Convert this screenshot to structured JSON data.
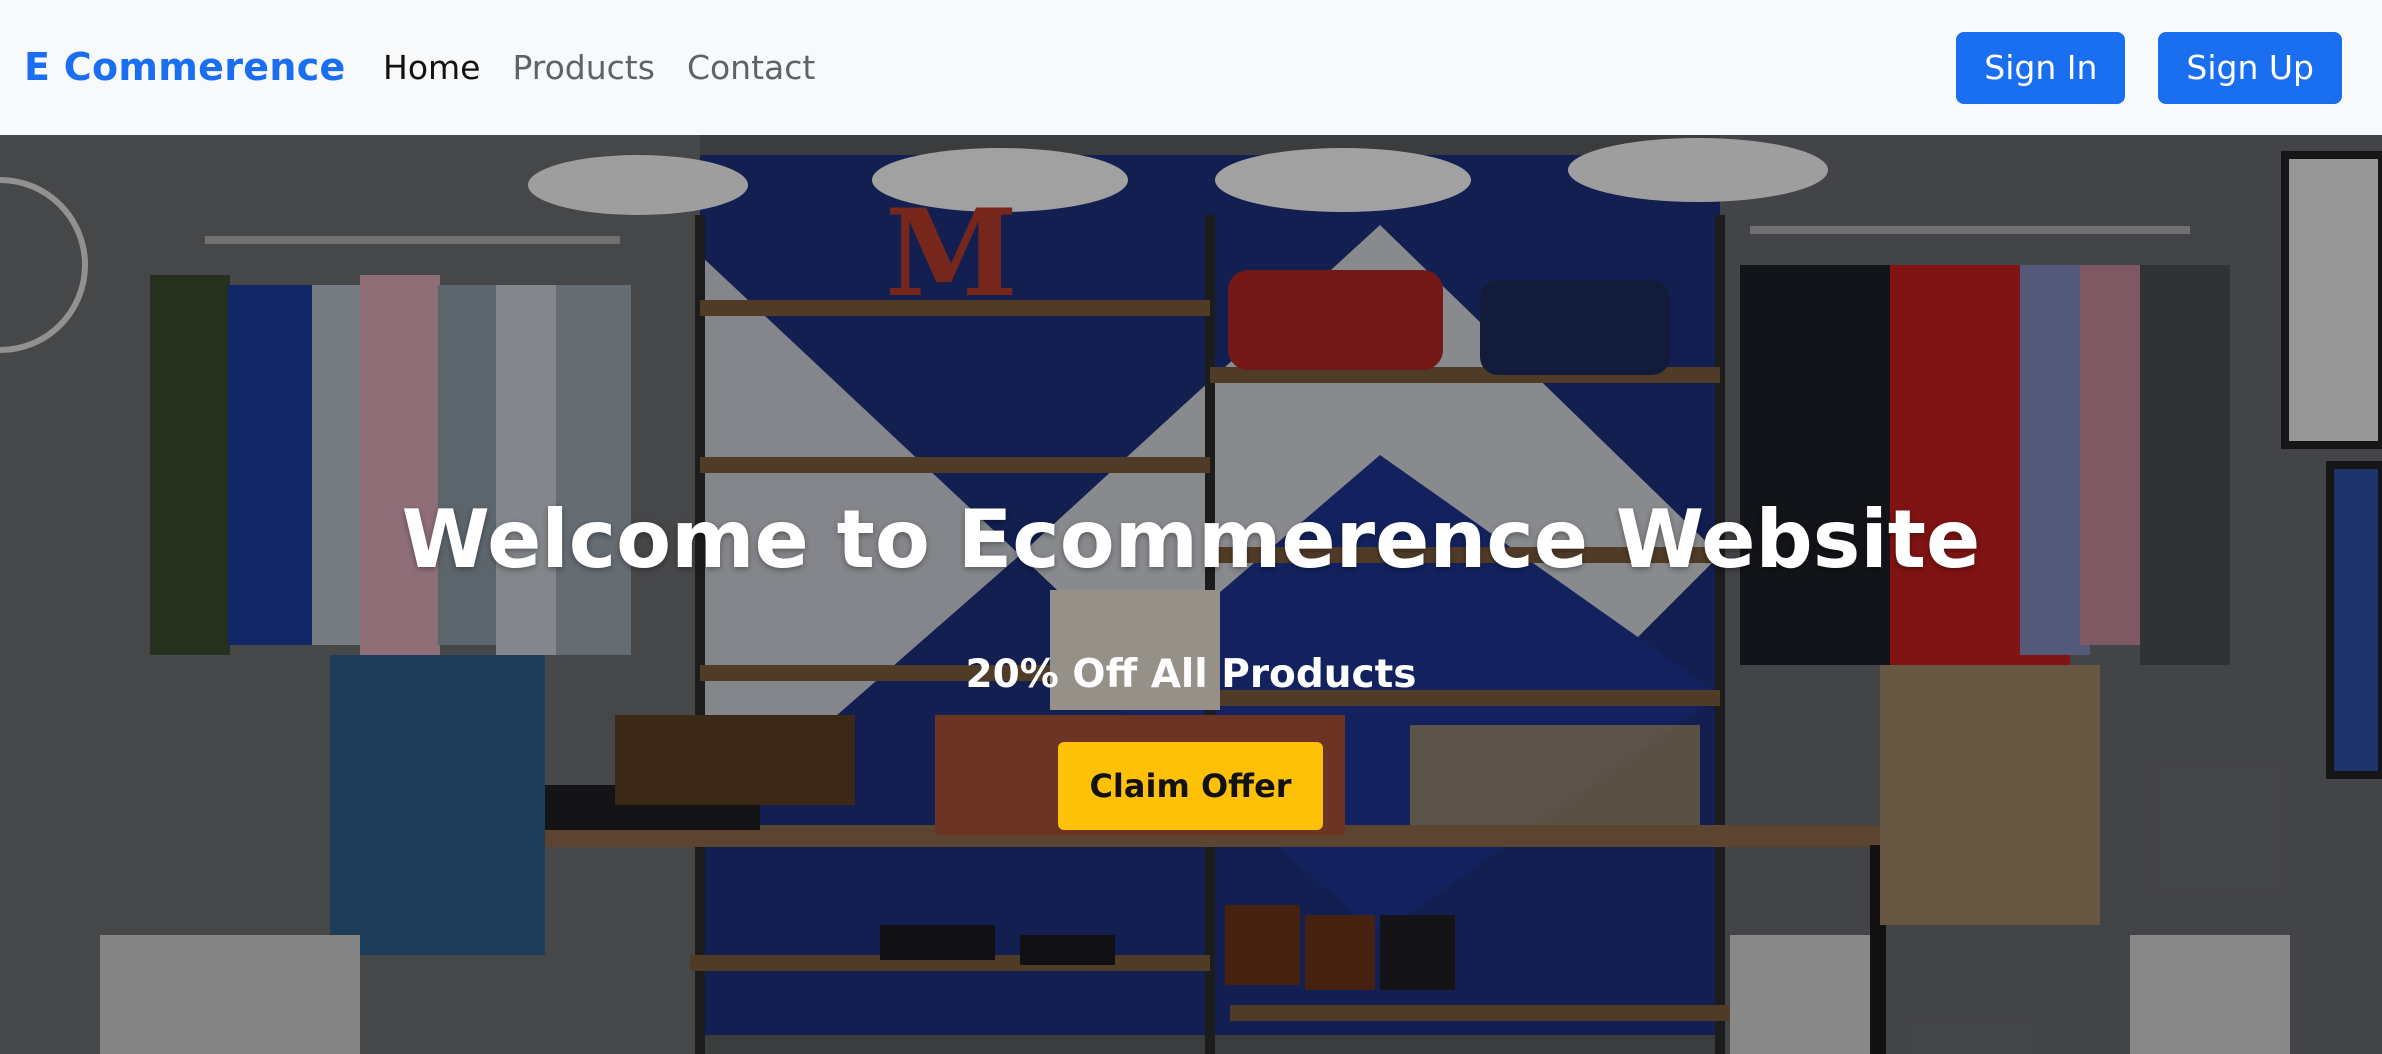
{
  "navbar": {
    "brand": "E Commerence",
    "links": [
      {
        "label": "Home",
        "active": true
      },
      {
        "label": "Products",
        "active": false
      },
      {
        "label": "Contact",
        "active": false
      }
    ],
    "sign_in": "Sign In",
    "sign_up": "Sign Up"
  },
  "hero": {
    "title": "Welcome to Ecommerence Website",
    "subtitle": "20% Off All Products",
    "cta_label": "Claim Offer",
    "background_image": "clothing-store-interior"
  },
  "colors": {
    "brand": "#1a6ef0",
    "primary_button": "#1a6ef0",
    "cta_button": "#ffc107",
    "navbar_bg": "#f8f9fa"
  }
}
